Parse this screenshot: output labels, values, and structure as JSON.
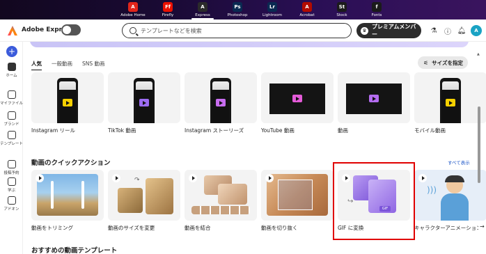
{
  "app_switcher": [
    {
      "label": "Adobe Home",
      "abbr": "A",
      "color": "#e1251b",
      "icon": "adobe-home-icon"
    },
    {
      "label": "Firefly",
      "abbr": "Ff",
      "color": "#eb1000",
      "icon": "firefly-icon"
    },
    {
      "label": "Express",
      "abbr": "A",
      "color": "#2b2b2b",
      "icon": "express-icon",
      "active": true
    },
    {
      "label": "Photoshop",
      "abbr": "Ps",
      "color": "#0a2a52",
      "icon": "photoshop-icon"
    },
    {
      "label": "Lightroom",
      "abbr": "Lr",
      "color": "#0a2a52",
      "icon": "lightroom-icon"
    },
    {
      "label": "Acrobat",
      "abbr": "A",
      "color": "#b30b00",
      "icon": "acrobat-icon"
    },
    {
      "label": "Stock",
      "abbr": "St",
      "color": "#1b1b1b",
      "icon": "stock-icon"
    },
    {
      "label": "Fonts",
      "abbr": "f",
      "color": "#1b1b1b",
      "icon": "fonts-icon"
    }
  ],
  "header": {
    "brand": "Adobe Express",
    "search_placeholder": "テンプレートなどを検索",
    "premium_label": "プレミアムメンバー",
    "avatar_initial": "A"
  },
  "rail": [
    {
      "label": "ホーム",
      "icon": "home-icon",
      "active": true
    },
    {
      "label": "マイファイル",
      "icon": "folder-icon"
    },
    {
      "label": "ブランド",
      "icon": "brand-icon"
    },
    {
      "label": "テンプレート",
      "icon": "template-icon"
    },
    {
      "label": "投稿予約",
      "icon": "calendar-icon"
    },
    {
      "label": "学ぶ",
      "icon": "learn-icon"
    },
    {
      "label": "アドオン",
      "icon": "addon-icon"
    }
  ],
  "tabs": [
    "人気",
    "一般動画",
    "SNS 動画"
  ],
  "size_button": "サイズを指定",
  "formats": [
    {
      "label": "Instagram リール",
      "kind": "phone",
      "play": "#f5d000"
    },
    {
      "label": "TikTok 動画",
      "kind": "phone",
      "play": "#9c6cf2"
    },
    {
      "label": "Instagram ストーリーズ",
      "kind": "phone",
      "play": "#c86df0"
    },
    {
      "label": "YouTube 動画",
      "kind": "wide",
      "play": "#e45bd8"
    },
    {
      "label": "動画",
      "kind": "wide",
      "play": "#b46cf0"
    },
    {
      "label": "モバイル動画",
      "kind": "phone",
      "play": "#f5d000"
    }
  ],
  "quick_actions_title": "動画のクイックアクション",
  "see_all": "すべて表示",
  "quick_actions": [
    {
      "label": "動画をトリミング"
    },
    {
      "label": "動画のサイズを変更"
    },
    {
      "label": "動画を結合"
    },
    {
      "label": "動画を切り抜く"
    },
    {
      "label": "GIF に変換"
    },
    {
      "label": "キャラクターアニメーションを作"
    }
  ],
  "recommended_title": "おすすめの動画テンプレート",
  "colors": {
    "accent": "#3b5bdb",
    "highlight": "#e00000"
  }
}
